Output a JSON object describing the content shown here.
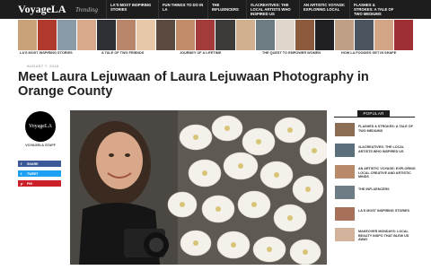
{
  "header": {
    "logo": "VoyageLA",
    "trending": "Trending",
    "links": [
      "LA's Most Inspiring Stories",
      "Fun things to do in LA",
      "The Influencers",
      "#LACreatives: The Local Artists Who Inspired Us",
      "An Artistic Voyage: Exploring Local",
      "Flashes & Strokes: A Tale of Two Mediums"
    ]
  },
  "strip_labels": [
    "LA's Most Inspiring Stories",
    "A Tale of Two Friends",
    "Journey of a Lifetime",
    "The Quest to Empower Women",
    "How LA Foodies Get in Shape"
  ],
  "article": {
    "date": "AUGUST 7, 2018",
    "title": "Meet Laura Lejuwaan of Laura Lejuwaan Photography in Orange County"
  },
  "author": {
    "avatar_text": "VoyageLA",
    "name": "VOYAGELA STAFF"
  },
  "share": {
    "facebook": "SHARE",
    "twitter": "TWEET",
    "pinterest": "PIN"
  },
  "sidebar": {
    "heading": "POPULAR",
    "items": [
      "Flashes & Strokes: A Tale of Two Mediums",
      "#LACreatives: The Local Artists Who Inspired Us",
      "An Artistic Voyage: Exploring Local Creative and Artistic Minds",
      "The Influencers",
      "LA's Most Inspiring Stories",
      "Makeover Mondays: Local Beauty Inspo That Blew Us Away"
    ]
  },
  "colors": {
    "nav_bg": "#1d1d1d",
    "facebook": "#3b5998",
    "twitter": "#1da1f2",
    "pinterest": "#cb2027"
  }
}
